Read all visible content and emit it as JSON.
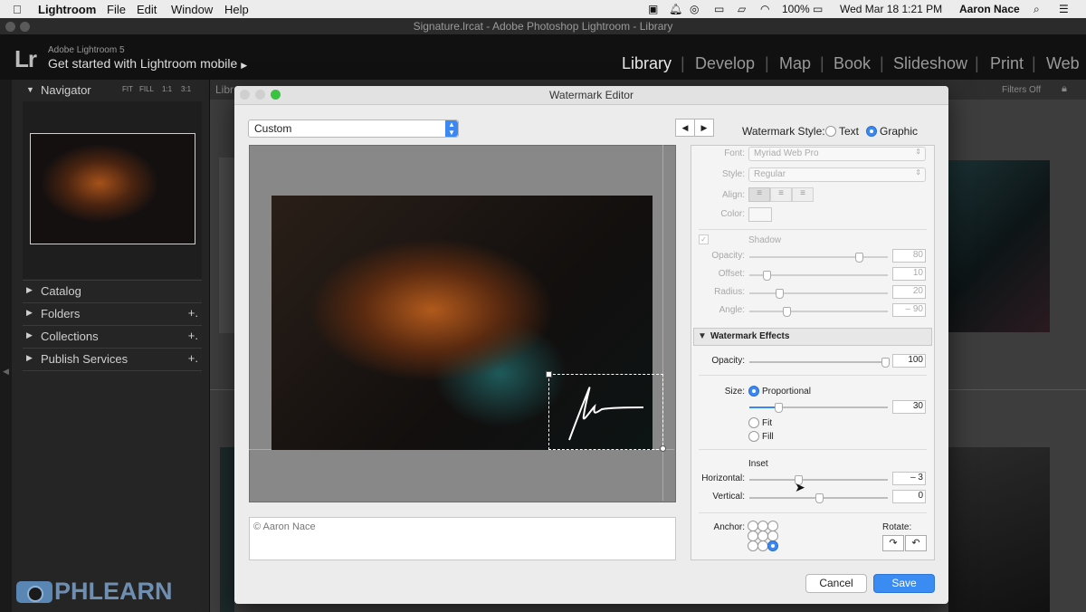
{
  "menubar": {
    "apple": "",
    "items": [
      "Lightroom",
      "File",
      "Edit",
      "Window",
      "Help"
    ],
    "battery": "100%",
    "datetime": "Wed Mar 18  1:21 PM",
    "user": "Aaron Nace"
  },
  "window_title": "Signature.lrcat - Adobe Photoshop Lightroom - Library",
  "identity": {
    "logo": "Lr",
    "product": "Adobe Lightroom 5",
    "mobile": "Get started with Lightroom mobile"
  },
  "modules": [
    "Library",
    "Develop",
    "Map",
    "Book",
    "Slideshow",
    "Print",
    "Web"
  ],
  "navigator": {
    "title": "Navigator",
    "zoom": [
      "FIT",
      "FILL",
      "1:1",
      "3:1"
    ]
  },
  "left_panels": [
    {
      "label": "Catalog",
      "plus": ""
    },
    {
      "label": "Folders",
      "plus": "+."
    },
    {
      "label": "Collections",
      "plus": "+."
    },
    {
      "label": "Publish Services",
      "plus": "+."
    }
  ],
  "filter": "Filters Off",
  "libr_tab": "Libr",
  "watermark_brand": "PHLEARN",
  "dialog": {
    "title": "Watermark Editor",
    "preset": "Custom",
    "watermark_style_label": "Watermark Style:",
    "style_text": "Text",
    "style_graphic": "Graphic",
    "caption": "© Aaron Nace",
    "text_options": {
      "font_label": "Font:",
      "font_value": "Myriad Web Pro",
      "style_label": "Style:",
      "style_value": "Regular",
      "align_label": "Align:",
      "color_label": "Color:"
    },
    "shadow": {
      "title": "Shadow",
      "opacity_label": "Opacity:",
      "opacity": "80",
      "offset_label": "Offset:",
      "offset": "10",
      "radius_label": "Radius:",
      "radius": "20",
      "angle_label": "Angle:",
      "angle": "– 90"
    },
    "effects": {
      "title": "Watermark Effects",
      "opacity_label": "Opacity:",
      "opacity": "100",
      "size_label": "Size:",
      "proportional": "Proportional",
      "size_value": "30",
      "fit": "Fit",
      "fill": "Fill",
      "inset_label": "Inset",
      "horizontal_label": "Horizontal:",
      "horizontal": "– 3",
      "vertical_label": "Vertical:",
      "vertical": "0",
      "anchor_label": "Anchor:",
      "rotate_label": "Rotate:"
    },
    "cancel": "Cancel",
    "save": "Save"
  }
}
